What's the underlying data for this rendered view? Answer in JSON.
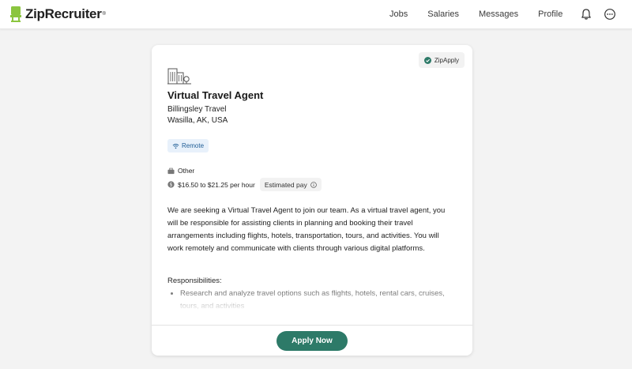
{
  "app": {
    "brand": "ZipRecruiter",
    "brand_tm": "®",
    "brand_color": "#8bc53f"
  },
  "nav": {
    "links": [
      {
        "label": "Jobs",
        "name": "nav-jobs"
      },
      {
        "label": "Salaries",
        "name": "nav-salaries"
      },
      {
        "label": "Messages",
        "name": "nav-messages"
      },
      {
        "label": "Profile",
        "name": "nav-profile"
      }
    ],
    "icons": [
      "bell-icon",
      "more-options-icon"
    ]
  },
  "job": {
    "apply_badge": "ZipApply",
    "title": "Virtual Travel Agent",
    "company": "Billingsley Travel",
    "location": "Wasilla, AK, USA",
    "workplace_badge": "Remote",
    "category": "Other",
    "pay": "$16.50 to $21.25 per hour",
    "pay_label": "Estimated pay",
    "description": "We are seeking a Virtual Travel Agent to join our team. As a virtual travel agent, you will be responsible for assisting clients in planning and booking their travel arrangements including flights, hotels, transportation, tours, and activities. You will work remotely and communicate with clients through various digital platforms.",
    "responsibilities_label": "Responsibilities:",
    "responsibilities": [
      "Research and analyze travel options such as flights, hotels, rental cars, cruises, tours, and activities"
    ],
    "apply_button": "Apply Now"
  },
  "colors": {
    "accent": "#2d7a68",
    "badge_bg": "#e8f1fb",
    "badge_text": "#1f5d95"
  }
}
